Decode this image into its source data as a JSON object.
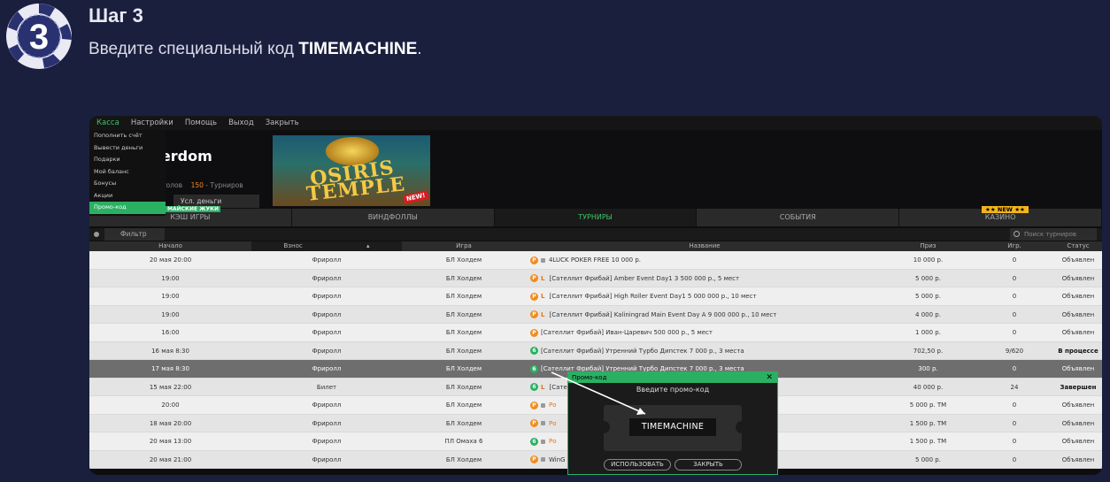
{
  "step": {
    "number": "3",
    "title": "Шаг 3",
    "text_prefix": "Введите специальный код ",
    "code": "TIMEMACHINE",
    "text_suffix": "."
  },
  "menu": [
    "Касса",
    "Настройки",
    "Помощь",
    "Выход",
    "Закрыть"
  ],
  "dropdown": [
    "Пополнить счёт",
    "Вывести деньги",
    "Подарки",
    "Мой баланс",
    "Бонусы",
    "Акции",
    "Промо-код"
  ],
  "header": {
    "logo": "Pokerdom",
    "tables_count": "10",
    "tables_label": "Столов",
    "tourn_count": "150",
    "tourn_label": "Турниров",
    "withdraw": "Усл. деньги",
    "promo_tag": "МАЙСКИЕ ЖУКИ",
    "banner_line1": "OSIRIS",
    "banner_line2": "TEMPLE",
    "banner_new": "NEW!"
  },
  "tabs": [
    "КЭШ ИГРЫ",
    "ВИНДФОЛЛЫ",
    "ТУРНИРЫ",
    "СОБЫТИЯ",
    "КАЗИНО"
  ],
  "new_badge": "★★ NEW ★★",
  "filter": {
    "label": "Фильтр",
    "search_placeholder": "Поиск турниров"
  },
  "columns": [
    "Начало",
    "Взнос",
    "Игра",
    "Название",
    "Приз",
    "Игр.",
    "Статус"
  ],
  "rows": [
    {
      "start": "20 мая 20:00",
      "fee": "Фриролл",
      "game": "БЛ Холдем",
      "name": "4LUCK POKER FREE 10 000 р.",
      "prize": "10 000 р.",
      "players": "0",
      "status": "Объявлен"
    },
    {
      "start": "19:00",
      "fee": "Фриролл",
      "game": "БЛ Холдем",
      "name": "[Сателлит Фрибай] Amber Event Day1 3 500 000 р., 5 мест",
      "prize": "5 000 р.",
      "players": "0",
      "status": "Объявлен"
    },
    {
      "start": "19:00",
      "fee": "Фриролл",
      "game": "БЛ Холдем",
      "name": "[Сателлит Фрибай] High Roller Event Day1 5 000 000 р., 10 мест",
      "prize": "5 000 р.",
      "players": "0",
      "status": "Объявлен"
    },
    {
      "start": "19:00",
      "fee": "Фриролл",
      "game": "БЛ Холдем",
      "name": "[Сателлит Фрибай] Kaliningrad Main Event Day A 9 000 000 р., 10 мест",
      "prize": "4 000 р.",
      "players": "0",
      "status": "Объявлен"
    },
    {
      "start": "16:00",
      "fee": "Фриролл",
      "game": "БЛ Холдем",
      "name": "[Сателлит Фрибай] Иван-Царевич 500 000 р., 5 мест",
      "prize": "1 000 р.",
      "players": "0",
      "status": "Объявлен"
    },
    {
      "start": "16 мая 8:30",
      "fee": "Фриролл",
      "game": "БЛ Холдем",
      "name": "[Сателлит Фрибай] Утренний Турбо Дипстек 7 000 р., 3 места",
      "prize": "702,50 р.",
      "players": "9/620",
      "status": "В процессе"
    },
    {
      "start": "17 мая 8:30",
      "fee": "Фриролл",
      "game": "БЛ Холдем",
      "name": "[Сателлит Фрибай] Утренний Турбо Дипстек 7 000 р., 3 места",
      "prize": "300 р.",
      "players": "0",
      "status": "Объявлен"
    },
    {
      "start": "15 мая 22:00",
      "fee": "Билет",
      "game": "БЛ Холдем",
      "name": "[Сате",
      "prize": "40 000 р.",
      "players": "24",
      "status": "Завершен"
    },
    {
      "start": "20:00",
      "fee": "Фриролл",
      "game": "БЛ Холдем",
      "name": "Ро",
      "prize": "5 000 р. ТМ",
      "players": "0",
      "status": "Объявлен"
    },
    {
      "start": "18 мая 20:00",
      "fee": "Фриролл",
      "game": "БЛ Холдем",
      "name": "Ро",
      "prize": "1 500 р. ТМ",
      "players": "0",
      "status": "Объявлен"
    },
    {
      "start": "20 мая 13:00",
      "fee": "Фриролл",
      "game": "ПЛ Омаха 6",
      "name": "Ро",
      "prize": "1 500 р. ТМ",
      "players": "0",
      "status": "Объявлен"
    },
    {
      "start": "20 мая 21:00",
      "fee": "Фриролл",
      "game": "БЛ Холдем",
      "name": "WinG",
      "prize": "5 000 р.",
      "players": "0",
      "status": "Объявлен"
    }
  ],
  "promo": {
    "title": "Промо-код",
    "close": "✕",
    "label": "Введите промо-код",
    "code": "TIMEMACHINE",
    "use": "ИСПОЛЬЗОВАТЬ",
    "close_btn": "ЗАКРЫТЬ"
  },
  "colors": {
    "accent_green": "#2bb063",
    "orange": "#f08c1e",
    "background": "#1a1f3e"
  }
}
